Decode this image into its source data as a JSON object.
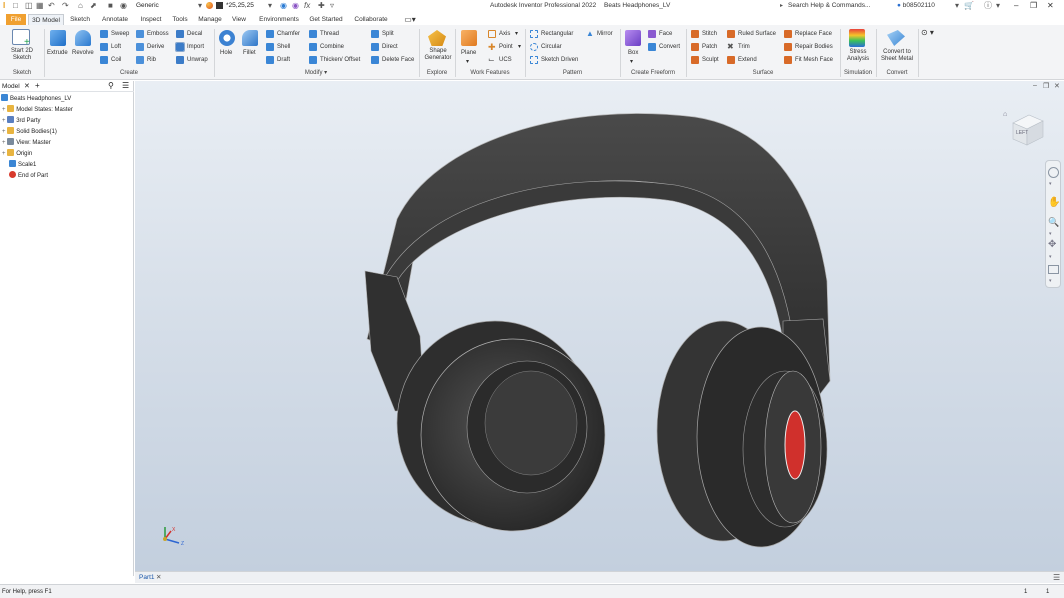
{
  "title_bar": {
    "app_title": "Autodesk Inventor Professional 2022",
    "document": "Beats Headphones_LV",
    "material": "Generic",
    "appearance_value": "*25,25,25",
    "search_placeholder": "Search Help & Commands...",
    "user": "b08502110"
  },
  "tabs": [
    "File",
    "3D Model",
    "Sketch",
    "Annotate",
    "Inspect",
    "Tools",
    "Manage",
    "View",
    "Environments",
    "Get Started",
    "Collaborate"
  ],
  "active_tab": "3D Model",
  "ribbon": {
    "sketch": {
      "title": "Sketch",
      "start_sketch": "Start 2D Sketch"
    },
    "create": {
      "title": "Create",
      "extrude": "Extrude",
      "revolve": "Revolve",
      "sweep": "Sweep",
      "loft": "Loft",
      "coil": "Coil",
      "emboss": "Emboss",
      "derive": "Derive",
      "rib": "Rib",
      "decal": "Decal",
      "import": "Import",
      "unwrap": "Unwrap"
    },
    "modify": {
      "title": "Modify",
      "hole": "Hole",
      "fillet": "Fillet",
      "chamfer": "Chamfer",
      "shell": "Shell",
      "draft": "Draft",
      "thread": "Thread",
      "combine": "Combine",
      "thicken_offset": "Thicken/ Offset",
      "split": "Split",
      "direct": "Direct",
      "delete_face": "Delete Face"
    },
    "explore": {
      "title": "Explore",
      "shape_generator": "Shape Generator"
    },
    "work_features": {
      "title": "Work Features",
      "plane": "Plane",
      "axis": "Axis",
      "point": "Point",
      "ucs": "UCS"
    },
    "pattern": {
      "title": "Pattern",
      "rectangular": "Rectangular",
      "circular": "Circular",
      "sketch_driven": "Sketch Driven",
      "mirror": "Mirror"
    },
    "create_freeform": {
      "title": "Create Freeform",
      "box": "Box",
      "face": "Face",
      "convert": "Convert"
    },
    "surface": {
      "title": "Surface",
      "stitch": "Stitch",
      "patch": "Patch",
      "sculpt": "Sculpt",
      "ruled_surface": "Ruled Surface",
      "trim": "Trim",
      "extend": "Extend",
      "replace_face": "Replace Face",
      "repair_bodies": "Repair Bodies",
      "fit_mesh_face": "Fit Mesh Face"
    },
    "simulation": {
      "title": "Simulation",
      "stress_analysis": "Stress Analysis"
    },
    "convert": {
      "title": "Convert",
      "convert_to_sheet_metal": "Convert to Sheet Metal"
    }
  },
  "browser": {
    "tab_label": "Model",
    "items": [
      {
        "label": "Beats Headphones_LV",
        "level": 0
      },
      {
        "label": "Model States: Master",
        "level": 1
      },
      {
        "label": "3rd Party",
        "level": 1
      },
      {
        "label": "Solid Bodies(1)",
        "level": 1
      },
      {
        "label": "View: Master",
        "level": 1
      },
      {
        "label": "Origin",
        "level": 1
      },
      {
        "label": "Scale1",
        "level": 1
      },
      {
        "label": "End of Part",
        "level": 1
      }
    ]
  },
  "viewcube": {
    "face": "LEFT"
  },
  "doc_tab": "Part1",
  "status": {
    "help_text": "For Help, press F1",
    "count_a": "1",
    "count_b": "1"
  },
  "colors": {
    "file_tab": "#f0a030",
    "accent": "#0e64b4",
    "model": "#3c3c3c",
    "speaker_red": "#d0302c"
  }
}
